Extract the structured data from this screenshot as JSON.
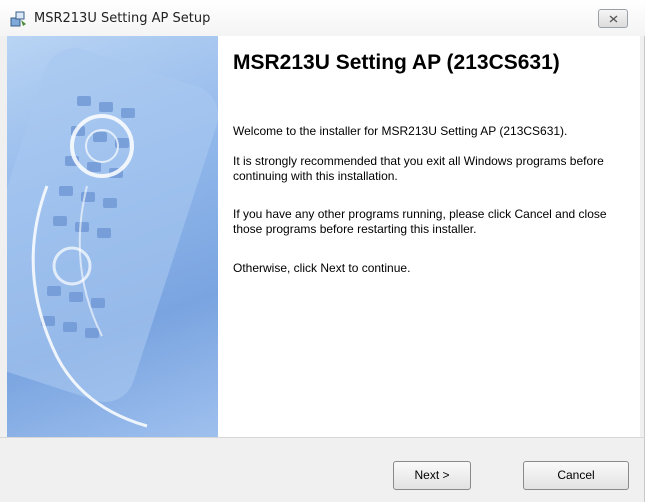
{
  "window": {
    "title": "MSR213U Setting AP Setup",
    "icon": "installer-icon",
    "close_icon": "close-icon"
  },
  "main": {
    "heading": "MSR213U Setting AP (213CS631)",
    "paragraphs": [
      "Welcome to the installer for MSR213U Setting AP (213CS631).",
      "It is strongly recommended that you exit all Windows programs before continuing with this installation.",
      "If you have any other programs running, please click Cancel and close those programs before restarting this installer.",
      "Otherwise, click Next to continue."
    ]
  },
  "buttons": {
    "next": "Next >",
    "cancel": "Cancel"
  },
  "colors": {
    "banner_blue": "#8fb6ea",
    "dialog_bg": "#f0f0f0"
  }
}
